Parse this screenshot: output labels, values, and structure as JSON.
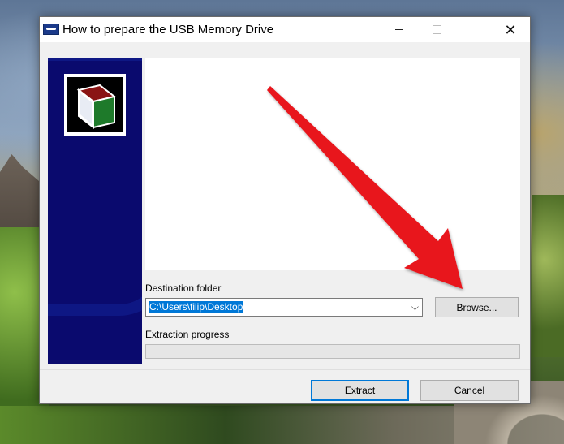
{
  "window": {
    "title": "How to prepare the USB Memory Drive",
    "minimize_icon": "minimize-icon",
    "maximize_icon": "maximize-icon",
    "close_icon": "close-icon",
    "close_glyph": "✕"
  },
  "destination": {
    "label": "Destination folder",
    "value": "C:\\Users\\filip\\Desktop",
    "dropdown_glyph": "⌵"
  },
  "browse_button": {
    "label": "Browse..."
  },
  "extraction": {
    "label": "Extraction progress",
    "progress": 0
  },
  "buttons": {
    "extract": "Extract",
    "cancel": "Cancel"
  },
  "colors": {
    "banner": "#0a0a6e",
    "accent": "#0078d7",
    "arrow": "#e8141b"
  }
}
